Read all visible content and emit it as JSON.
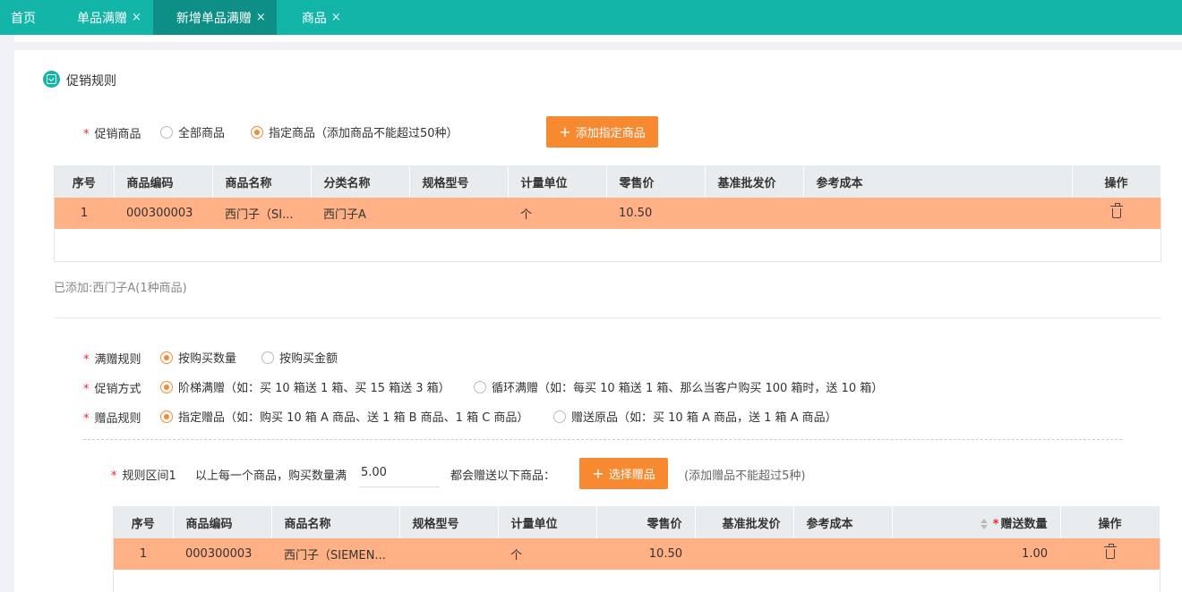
{
  "tabs": [
    {
      "label": "首页",
      "closable": false
    },
    {
      "label": "单品满赠",
      "closable": true
    },
    {
      "label": "新增单品满赠",
      "closable": true,
      "active": true
    },
    {
      "label": "商品",
      "closable": true
    }
  ],
  "close_glyph": "×",
  "section_title": "促销规则",
  "required_mark": "*",
  "promo_goods": {
    "label": "促销商品",
    "options": [
      "全部商品",
      "指定商品（添加商品不能超过50种）"
    ],
    "selected": 1,
    "add_button": "添加指定商品"
  },
  "goods_table": {
    "headers": [
      "序号",
      "商品编码",
      "商品名称",
      "分类名称",
      "规格型号",
      "计量单位",
      "零售价",
      "基准批发价",
      "参考成本",
      "操作"
    ],
    "rows": [
      {
        "seq": "1",
        "code": "000300003",
        "name": "西门子（SI...",
        "category": "西门子A",
        "spec": "",
        "unit": "个",
        "retail": "10.50",
        "wholesale": "",
        "cost": ""
      }
    ]
  },
  "added_summary": "已添加:西门子A(1种商品)",
  "rule_type": {
    "label": "满赠规则",
    "options": [
      "按购买数量",
      "按购买金额"
    ],
    "selected": 0
  },
  "promo_method": {
    "label": "促销方式",
    "options": [
      "阶梯满赠（如：买 10 箱送 1 箱、买 15 箱送 3 箱）",
      "循环满赠（如：每买 10 箱送 1 箱、那么当客户购买 100 箱时，送 10 箱）"
    ],
    "selected": 0
  },
  "gift_rule": {
    "label": "赠品规则",
    "options": [
      "指定赠品（如：购买 10 箱 A 商品、送 1 箱 B 商品、1 箱 C 商品）",
      "赠送原品（如：买 10 箱 A 商品，送 1 箱 A 商品）"
    ],
    "selected": 0
  },
  "interval": {
    "label": "规则区间1",
    "prefix": "以上每一个商品，购买数量满",
    "value": "5.00",
    "suffix": "都会赠送以下商品：",
    "select_button": "选择赠品",
    "hint": "(添加赠品不能超过5种)"
  },
  "gift_table": {
    "headers": [
      "序号",
      "商品编码",
      "商品名称",
      "规格型号",
      "计量单位",
      "零售价",
      "基准批发价",
      "参考成本",
      "赠送数量",
      "操作"
    ],
    "rows": [
      {
        "seq": "1",
        "code": "000300003",
        "name": "西门子（SIEMEN...",
        "spec": "",
        "unit": "个",
        "retail": "10.50",
        "wholesale": "",
        "cost": "",
        "qty": "1.00"
      }
    ]
  },
  "colors": {
    "tabbar": "#13b5a8",
    "tab_active": "#0e8f85",
    "accent": "#f78931",
    "selected_row": "#ffb185"
  }
}
